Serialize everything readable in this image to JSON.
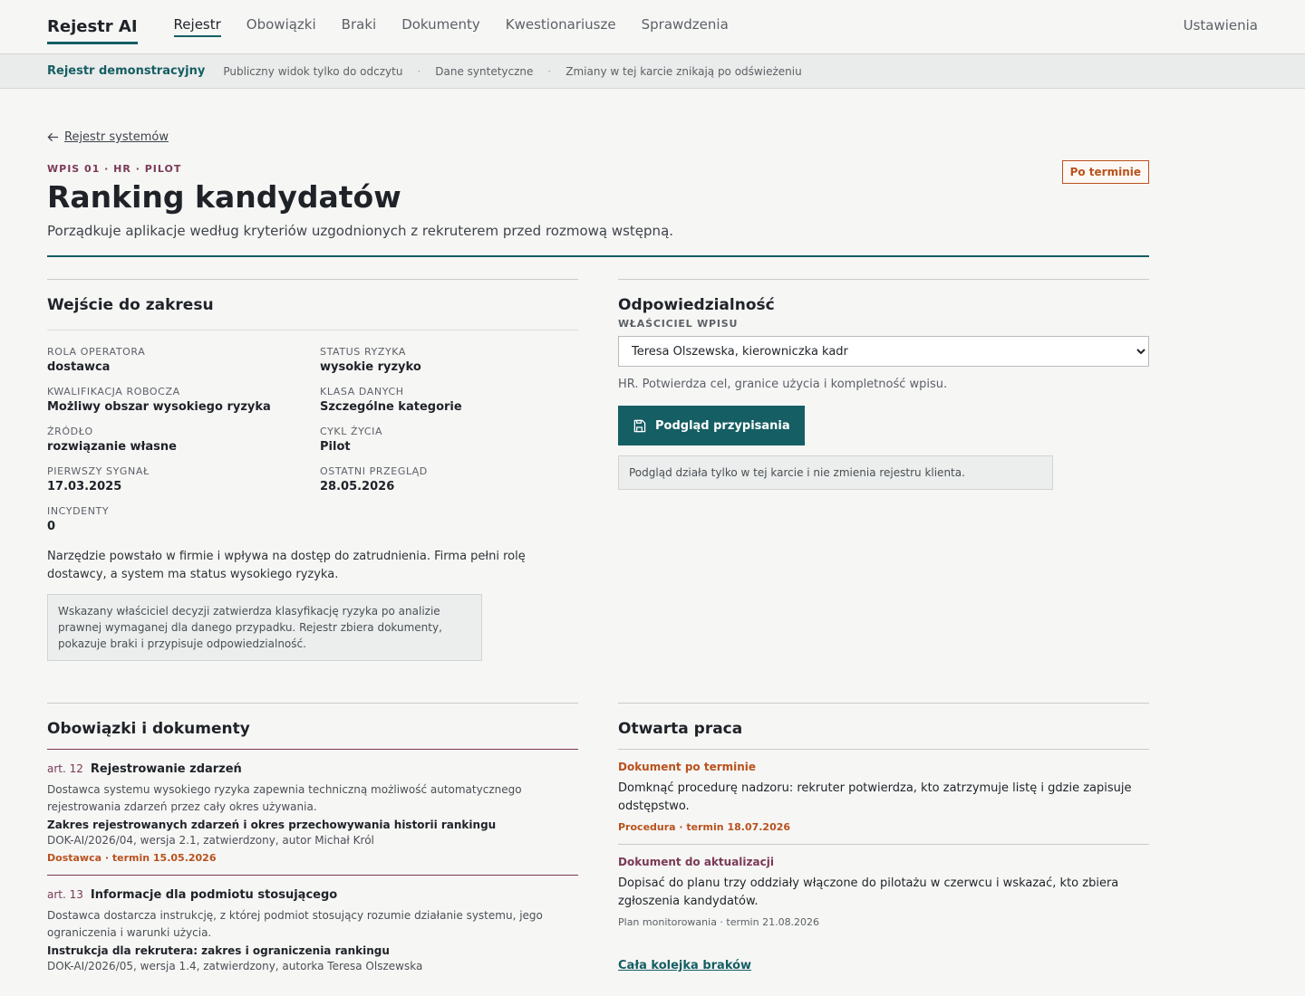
{
  "header": {
    "brand": "Rejestr AI",
    "nav": [
      "Rejestr",
      "Obowiązki",
      "Braki",
      "Dokumenty",
      "Kwestionariusze",
      "Sprawdzenia"
    ],
    "active_nav": "Rejestr",
    "settings": "Ustawienia"
  },
  "demo": {
    "title": "Rejestr demonstracyjny",
    "notes": [
      "Publiczny widok tylko do odczytu",
      "Dane syntetyczne",
      "Zmiany w tej karcie znikają po odświeżeniu"
    ]
  },
  "page": {
    "back_link": "Rejestr systemów",
    "eyebrow": "WPIS 01 · HR · PILOT",
    "status_badge": "Po terminie",
    "title": "Ranking kandydatów",
    "description": "Porządkuje aplikacje według kryteriów uzgodnionych z rekruterem przed rozmową wstępną."
  },
  "scope": {
    "heading": "Wejście do zakresu",
    "facts": [
      {
        "label": "ROLA OPERATORA",
        "value": "dostawca"
      },
      {
        "label": "STATUS RYZYKA",
        "value": "wysokie ryzyko"
      },
      {
        "label": "KWALIFIKACJA ROBOCZA",
        "value": "Możliwy obszar wysokiego ryzyka"
      },
      {
        "label": "KLASA DANYCH",
        "value": "Szczególne kategorie"
      },
      {
        "label": "ŹRÓDŁO",
        "value": "rozwiązanie własne"
      },
      {
        "label": "CYKL ŻYCIA",
        "value": "Pilot"
      },
      {
        "label": "PIERWSZY SYGNAŁ",
        "value": "17.03.2025"
      },
      {
        "label": "OSTATNI PRZEGLĄD",
        "value": "28.05.2026"
      },
      {
        "label": "INCYDENTY",
        "value": "0"
      }
    ],
    "text": "Narzędzie powstało w firmie i wpływa na dostęp do zatrudnienia. Firma pełni rolę dostawcy, a system ma status wysokiego ryzyka.",
    "note": "Wskazany właściciel decyzji zatwierdza klasyfikację ryzyka po analizie prawnej wymaganej dla danego przypadku. Rejestr zbiera dokumenty, pokazuje braki i przypisuje odpowiedzialność."
  },
  "responsibility": {
    "heading": "Odpowiedzialność",
    "owner_label": "WŁAŚCICIEL WPISU",
    "owner_selected": "Teresa Olszewska, kierowniczka kadr",
    "help": "HR. Potwierdza cel, granice użycia i kompletność wpisu.",
    "button": "Podgląd przypisania",
    "note": "Podgląd działa tylko w tej karcie i nie zmienia rejestru klienta."
  },
  "duties": {
    "heading": "Obowiązki i dokumenty",
    "items": [
      {
        "art": "art. 12",
        "title": "Rejestrowanie zdarzeń",
        "desc": "Dostawca systemu wysokiego ryzyka zapewnia techniczną możliwość automatycznego rejestrowania zdarzeń przez cały okres używania.",
        "doc": "Zakres rejestrowanych zdarzeń i okres przechowywania historii rankingu",
        "meta": "DOK-AI/2026/04, wersja 2.1, zatwierdzony, autor Michał Król",
        "tag": "Dostawca · termin 15.05.2026"
      },
      {
        "art": "art. 13",
        "title": "Informacje dla podmiotu stosującego",
        "desc": "Dostawca dostarcza instrukcję, z której podmiot stosujący rozumie działanie systemu, jego ograniczenia i warunki użycia.",
        "doc": "Instrukcja dla rekrutera: zakres i ograniczenia rankingu",
        "meta": "DOK-AI/2026/05, wersja 1.4, zatwierdzony, autorka Teresa Olszewska",
        "tag": ""
      }
    ]
  },
  "work": {
    "heading": "Otwarta praca",
    "items": [
      {
        "type": "Dokument po terminie",
        "kind": "late",
        "text": "Domknąć procedurę nadzoru: rekruter potwierdza, kto zatrzymuje listę i gdzie zapisuje odstępstwo.",
        "tag": "Procedura · termin 18.07.2026"
      },
      {
        "type": "Dokument do aktualizacji",
        "kind": "update",
        "text": "Dopisać do planu trzy oddziały włączone do pilotażu w czerwcu i wskazać, kto zbiera zgłoszenia kandydatów.",
        "tag": "Plan monitorowania · termin 21.08.2026"
      }
    ],
    "queue_link": "Cała kolejka braków"
  }
}
